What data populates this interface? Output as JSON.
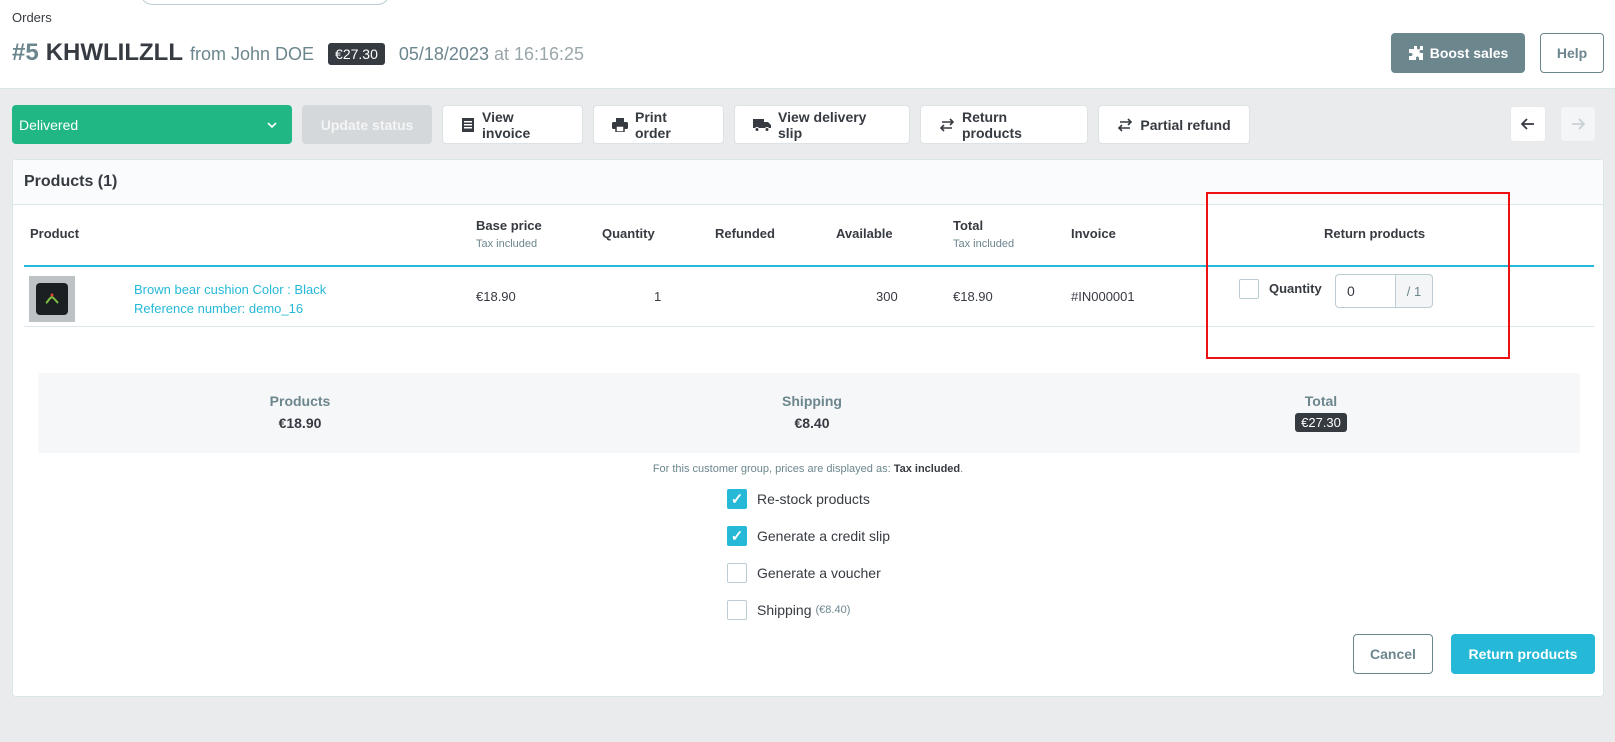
{
  "header": {
    "breadcrumb": "Orders",
    "order_number": "#5",
    "order_reference": "KHWLILZLL",
    "customer_text": "from John DOE",
    "order_total": "€27.30",
    "order_date": "05/18/2023",
    "at_word": "at",
    "order_time": "16:16:25",
    "boost_label": "Boost sales",
    "help_label": "Help"
  },
  "toolbar": {
    "status_value": "Delivered",
    "update_status_label": "Update status",
    "view_invoice_label": "View invoice",
    "print_order_label": "Print order",
    "view_delivery_slip_label": "View delivery slip",
    "return_products_label": "Return products",
    "partial_refund_label": "Partial refund"
  },
  "products": {
    "title": "Products (1)",
    "columns": {
      "product": "Product",
      "base_price": "Base price",
      "base_price_sub": "Tax included",
      "quantity": "Quantity",
      "refunded": "Refunded",
      "available": "Available",
      "total": "Total",
      "total_sub": "Tax included",
      "invoice": "Invoice",
      "return_products": "Return products"
    },
    "rows": [
      {
        "name": "Brown bear cushion Color : Black",
        "reference": "Reference number: demo_16",
        "base_price": "€18.90",
        "quantity": "1",
        "refunded": "",
        "available": "300",
        "total": "€18.90",
        "invoice": "#IN000001",
        "return_checked": false,
        "return_qty_label": "Quantity",
        "return_qty_value": "0",
        "return_qty_max": "/ 1"
      }
    ]
  },
  "summary": {
    "products_label": "Products",
    "products_value": "€18.90",
    "shipping_label": "Shipping",
    "shipping_value": "€8.40",
    "total_label": "Total",
    "total_value": "€27.30"
  },
  "tax_note": {
    "text": "For this customer group, prices are displayed as:",
    "mode": "Tax included",
    "dot": "."
  },
  "options": [
    {
      "label": "Re-stock products",
      "checked": true,
      "extra": ""
    },
    {
      "label": "Generate a credit slip",
      "checked": true,
      "extra": ""
    },
    {
      "label": "Generate a voucher",
      "checked": false,
      "extra": ""
    },
    {
      "label": "Shipping",
      "checked": false,
      "extra": "(€8.40)"
    }
  ],
  "actions": {
    "cancel_label": "Cancel",
    "submit_label": "Return products"
  },
  "colors": {
    "accent": "#25b9d7",
    "status_green": "#20b785",
    "highlight_red": "#e11111"
  }
}
